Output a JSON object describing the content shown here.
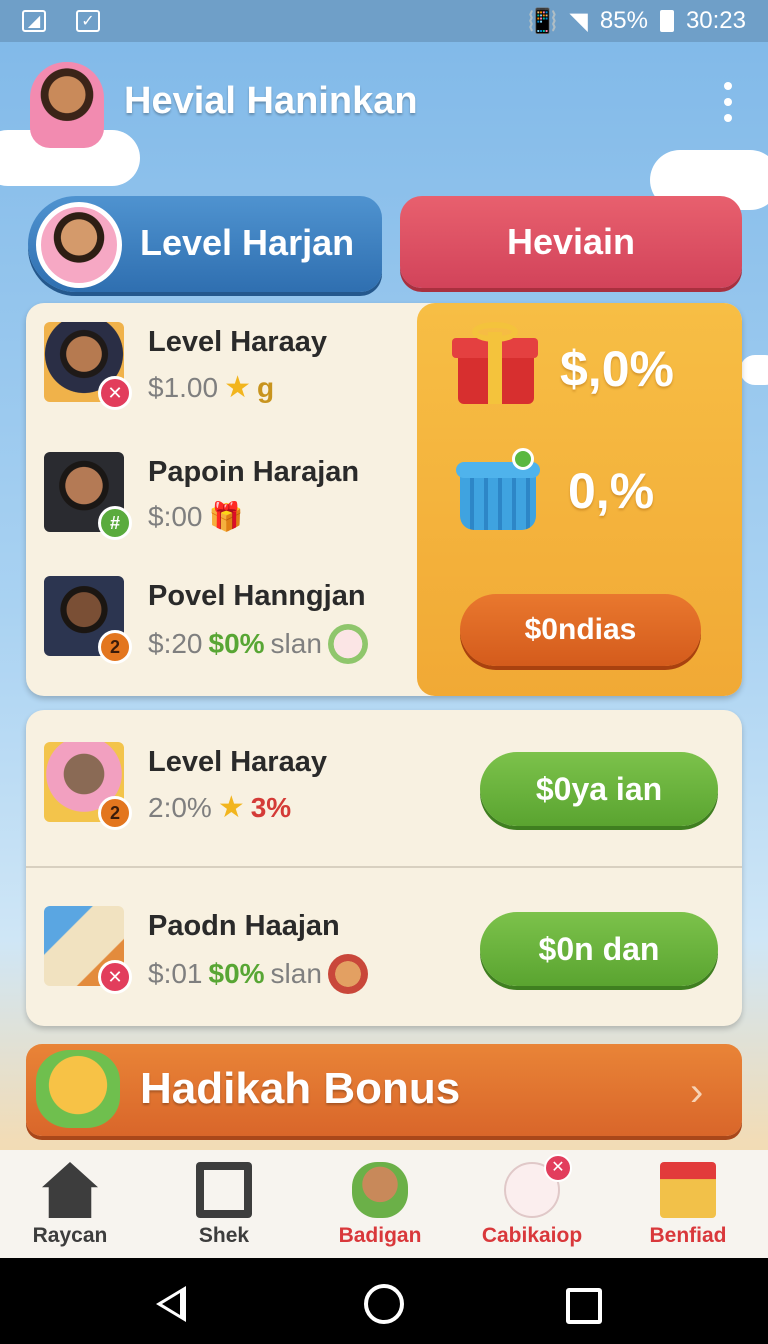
{
  "status_bar": {
    "battery": "85%",
    "time": "30:23"
  },
  "header": {
    "title": "Hevial Haninkan"
  },
  "tabs": {
    "level_label": "Level Harjan",
    "hevi_label": "Heviain"
  },
  "main_list": [
    {
      "name": "Level Haraay",
      "value": "$1.00",
      "extra": "g"
    },
    {
      "name": "Papoin Harajan",
      "value": "$:00"
    },
    {
      "name": "Povel Hanngjan",
      "value": "$:20",
      "percent": "$0%",
      "suffix": "slan"
    }
  ],
  "panel": {
    "value1": "$,0%",
    "value2": "0,%",
    "button_label": "$0ndias"
  },
  "secondary_list": [
    {
      "name": "Level Haraay",
      "value": "2:0%",
      "percent": "3%",
      "button_label": "$0ya ian"
    },
    {
      "name": "Paodn Haajan",
      "value": "$:01",
      "percent": "$0%",
      "suffix": "slan",
      "button_label": "$0n dan"
    }
  ],
  "bonus": {
    "label": "Hadikah Bonus"
  },
  "bottom_nav": [
    {
      "label": "Raycan",
      "color": "#3d3d3d",
      "icon": "home-icon"
    },
    {
      "label": "Shek",
      "color": "#3d3d3d",
      "icon": "photo-icon"
    },
    {
      "label": "Badigan",
      "color": "#d9383b",
      "icon": "bear-icon"
    },
    {
      "label": "Cabikaiop",
      "color": "#d9383b",
      "icon": "cat-icon"
    },
    {
      "label": "Benfiad",
      "color": "#d9383b",
      "icon": "gift-icon"
    }
  ]
}
